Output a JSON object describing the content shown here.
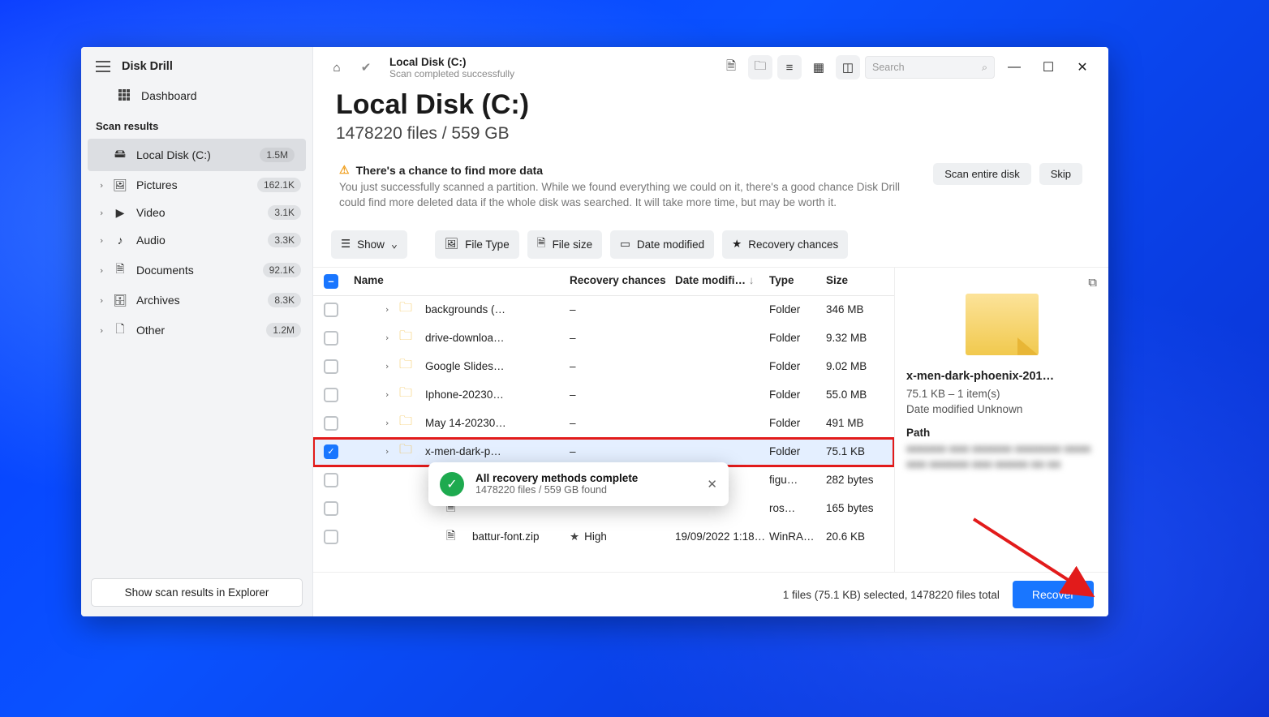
{
  "app": {
    "name": "Disk Drill",
    "dashboard": "Dashboard"
  },
  "sidebar": {
    "section": "Scan results",
    "items": [
      {
        "label": "Local Disk (C:)",
        "count": "1.5M",
        "active": true
      },
      {
        "label": "Pictures",
        "count": "162.1K"
      },
      {
        "label": "Video",
        "count": "3.1K"
      },
      {
        "label": "Audio",
        "count": "3.3K"
      },
      {
        "label": "Documents",
        "count": "92.1K"
      },
      {
        "label": "Archives",
        "count": "8.3K"
      },
      {
        "label": "Other",
        "count": "1.2M"
      }
    ],
    "bottom": "Show scan results in Explorer"
  },
  "toolbar": {
    "breadcrumb_title": "Local Disk (C:)",
    "breadcrumb_sub": "Scan completed successfully",
    "search_placeholder": "Search"
  },
  "header": {
    "title": "Local Disk (C:)",
    "subtitle": "1478220 files / 559 GB"
  },
  "notice": {
    "title": "There's a chance to find more data",
    "body": "You just successfully scanned a partition. While we found everything we could on it, there's a good chance Disk Drill could find more deleted data if the whole disk was searched. It will take more time, but may be worth it.",
    "scan": "Scan entire disk",
    "skip": "Skip"
  },
  "filters": {
    "show": "Show",
    "filetype": "File Type",
    "filesize": "File size",
    "date": "Date modified",
    "chances": "Recovery chances"
  },
  "columns": {
    "name": "Name",
    "recovery": "Recovery chances",
    "date": "Date modifi…",
    "type": "Type",
    "size": "Size"
  },
  "rows": [
    {
      "name": "backgrounds (…",
      "rec": "–",
      "date": "",
      "type": "Folder",
      "size": "346 MB",
      "expand": true,
      "kind": "folder"
    },
    {
      "name": "drive-downloa…",
      "rec": "–",
      "date": "",
      "type": "Folder",
      "size": "9.32 MB",
      "expand": true,
      "kind": "folder"
    },
    {
      "name": "Google Slides…",
      "rec": "–",
      "date": "",
      "type": "Folder",
      "size": "9.02 MB",
      "expand": true,
      "kind": "folder"
    },
    {
      "name": "Iphone-20230…",
      "rec": "–",
      "date": "",
      "type": "Folder",
      "size": "55.0 MB",
      "expand": true,
      "kind": "folder"
    },
    {
      "name": "May 14-20230…",
      "rec": "–",
      "date": "",
      "type": "Folder",
      "size": "491 MB",
      "expand": true,
      "kind": "folder"
    },
    {
      "name": "x-men-dark-p…",
      "rec": "–",
      "date": "",
      "type": "Folder",
      "size": "75.1 KB",
      "expand": true,
      "kind": "folder",
      "selected": true,
      "highlighted": true
    },
    {
      "name": "",
      "rec": "",
      "date": "",
      "type": "figu…",
      "size": "282 bytes",
      "kind": "file"
    },
    {
      "name": "",
      "rec": "",
      "date": "",
      "type": "ros…",
      "size": "165 bytes",
      "kind": "file"
    },
    {
      "name": "battur-font.zip",
      "rec": "High",
      "date": "19/09/2022 1:18…",
      "type": "WinRA…",
      "size": "20.6 KB",
      "kind": "file",
      "starred": true
    }
  ],
  "preview": {
    "title": "x-men-dark-phoenix-201…",
    "line1": "75.1 KB – 1 item(s)",
    "line2": "Date modified Unknown",
    "section": "Path",
    "blur": "■■■■■■ ■■■ ■■■■■■\n■■■■■■■ ■■■■ ■■■ ■■■■■■ ■■■\n■■■■■ ■■ ■■"
  },
  "popup": {
    "title": "All recovery methods complete",
    "sub": "1478220 files / 559 GB found"
  },
  "footer": {
    "status": "1 files (75.1 KB) selected, 1478220 files total",
    "recover": "Recover"
  }
}
